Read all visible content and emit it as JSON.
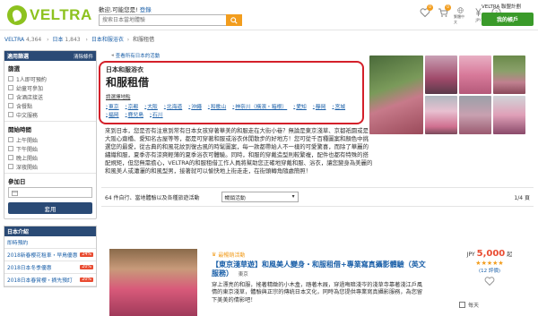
{
  "header": {
    "logo_text": "VELTRA",
    "welcome_text": "歡迎,可能您是!",
    "welcome_link": "登錄",
    "search_placeholder": "搜索日本當地體驗",
    "icons": [
      {
        "name": "favorite-icon",
        "label": "",
        "badge": "0"
      },
      {
        "name": "cart-icon",
        "label": "",
        "badge": "0"
      },
      {
        "name": "language-icon",
        "label": "繁體中文",
        "badge": ""
      },
      {
        "name": "currency-icon",
        "label": "JPY",
        "badge": ""
      },
      {
        "name": "help-icon",
        "label": "幫助",
        "badge": ""
      }
    ],
    "partner_link": "VELTRA 聯盟計劃",
    "my_account": "我的帳戶",
    "accent_color": "#8dc21f",
    "search_button_color": "#f29d1e"
  },
  "breadcrumb": {
    "items": [
      {
        "label": "VELTRA",
        "count": "4,364"
      },
      {
        "label": "日本",
        "count": "1,843"
      },
      {
        "label": "日本和服浴衣",
        "count": ""
      }
    ],
    "current": "和服租借"
  },
  "sidebar": {
    "filter_title": "適用篩選",
    "clear_label": "清除條件",
    "sections": [
      {
        "title": "篩選",
        "options": [
          "1人即可預約",
          "幼童可參加",
          "含酒店接送",
          "含餐點",
          "中文服務"
        ]
      },
      {
        "title": "開始時間",
        "options": [
          "上午開始",
          "下午開始",
          "晚上開始",
          "深夜開始"
        ]
      }
    ],
    "date_title": "參加日",
    "date_placeholder": "",
    "apply_label": "套用",
    "japan_title": "日本介紹",
    "japan_items": [
      {
        "label": "即時預約",
        "tag": ""
      },
      {
        "label": "2018新春櫻花租車・早鳥優惠",
        "tag": "24%"
      },
      {
        "label": "2018日本冬季優惠",
        "tag": "20%"
      },
      {
        "label": "2018日本春賞櫻・摘先預訂",
        "tag": "20%"
      }
    ]
  },
  "main": {
    "bookmark": "查看所有日本的活動",
    "title_sub": "日本和服浴衣",
    "title_main": "和服租借",
    "select_area": "請選擇地點",
    "areas": [
      "東京",
      "京都",
      "大阪",
      "北海道",
      "沖繩",
      "和歌山",
      "神奈川（橫濱・箱根）",
      "愛知",
      "靜岡",
      "宮城",
      "福岡",
      "鹿兒島",
      "石川"
    ],
    "description": "來到日本，您是否有注意到常有日本女孩穿著華美的和服走在大街小巷？無論是東京淺草、京都祇園或是大阪心齋橋、愛知名古屋等等，都是可穿著和服或浴衣休閒散步的好地方！您可從千百種圖案和顏色中挑選您的最愛，從古典的和風花紋到復古風的時髦圖案，每一款都帶給人不一樣的可愛驚喜，而除了華麗的繡織和服，夏季亦有涼爽輕薄的夏季浴衣可體驗。同時，和服的穿戴造型則較繁複，配件也都有特殊的搭配規矩，但您無需擔心，VELTRA的和服租借工作人員將幫助您正確地穿戴和服、浴衣，讓您變身為美麗的和風美人或瀟灑的和風型男，接著就可以愉快地上街走走，在街頭轉角隨處簡照！",
    "result_count": "64 件自行、當地體驗以及各種旅遊活動",
    "sort_label": "暢銷活動",
    "page_indicator": "1/4 頁"
  },
  "card": {
    "badge": "最暢銷活動",
    "title": "【東京淺草遊】和風美人變身・和服租借+專業寫真攝影體驗（英文服務）",
    "location": "東京",
    "description": "穿上漂亮的和服，搖著精緻的小木盒，踏著木屐，穿過晦暗淺岑的淺草寺靠著淺江戶風情的東京淺草，體驗與正宗的傳統日本文化，同時為您提供專業寫真攝影服務，為您留下美美的倩影吧！",
    "currency": "JPY",
    "price": "5,000",
    "price_suffix": "起",
    "stars": "★★★★★",
    "reviews": "(12 評價)",
    "daily": "每天"
  }
}
